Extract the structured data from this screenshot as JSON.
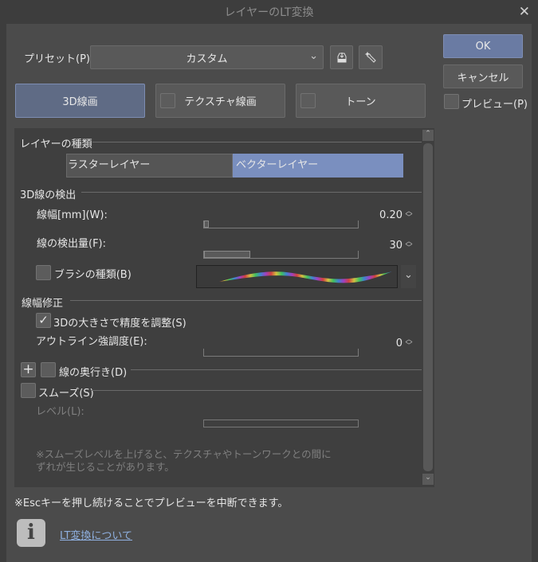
{
  "window": {
    "title": "レイヤーのLT変換",
    "close": "✕"
  },
  "preset": {
    "label": "プリセット(P):",
    "value": "カスタム"
  },
  "buttons": {
    "ok": "OK",
    "cancel": "キャンセル",
    "preview": "プレビュー(P)"
  },
  "tabs": [
    {
      "label": "3D線画",
      "active": true
    },
    {
      "label": "テクスチャ線画",
      "active": false
    },
    {
      "label": "トーン",
      "active": false
    }
  ],
  "layer_type": {
    "heading": "レイヤーの種類",
    "options": [
      "ラスターレイヤー",
      "ベクターレイヤー"
    ],
    "selected": "ベクターレイヤー"
  },
  "detect": {
    "heading": "3D線の検出",
    "width_label": "線幅[mm](W):",
    "width_value": "0.20",
    "amount_label": "線の検出量(F):",
    "amount_value": "30",
    "brush_label": "ブラシの種類(B)"
  },
  "correct": {
    "heading": "線幅修正",
    "adjust_label": "3Dの大きさで精度を調整(S)",
    "adjust_checked": true,
    "outline_label": "アウトライン強調度(E):",
    "outline_value": "0"
  },
  "depth": {
    "label": "線の奥行き(D)"
  },
  "smooth": {
    "label": "スムーズ(S)",
    "level_label": "レベル(L):",
    "note1": "※スムーズレベルを上げると、テクスチャやトーンワークとの間に",
    "note2": "ずれが生じることがあります。"
  },
  "footer": {
    "esc_note": "※Escキーを押し続けることでプレビューを中断できます。",
    "link": "LT変換について"
  },
  "colors": {
    "accent": "#6a7ba3",
    "selected": "#7a8fbf",
    "link": "#8fb0e0"
  }
}
